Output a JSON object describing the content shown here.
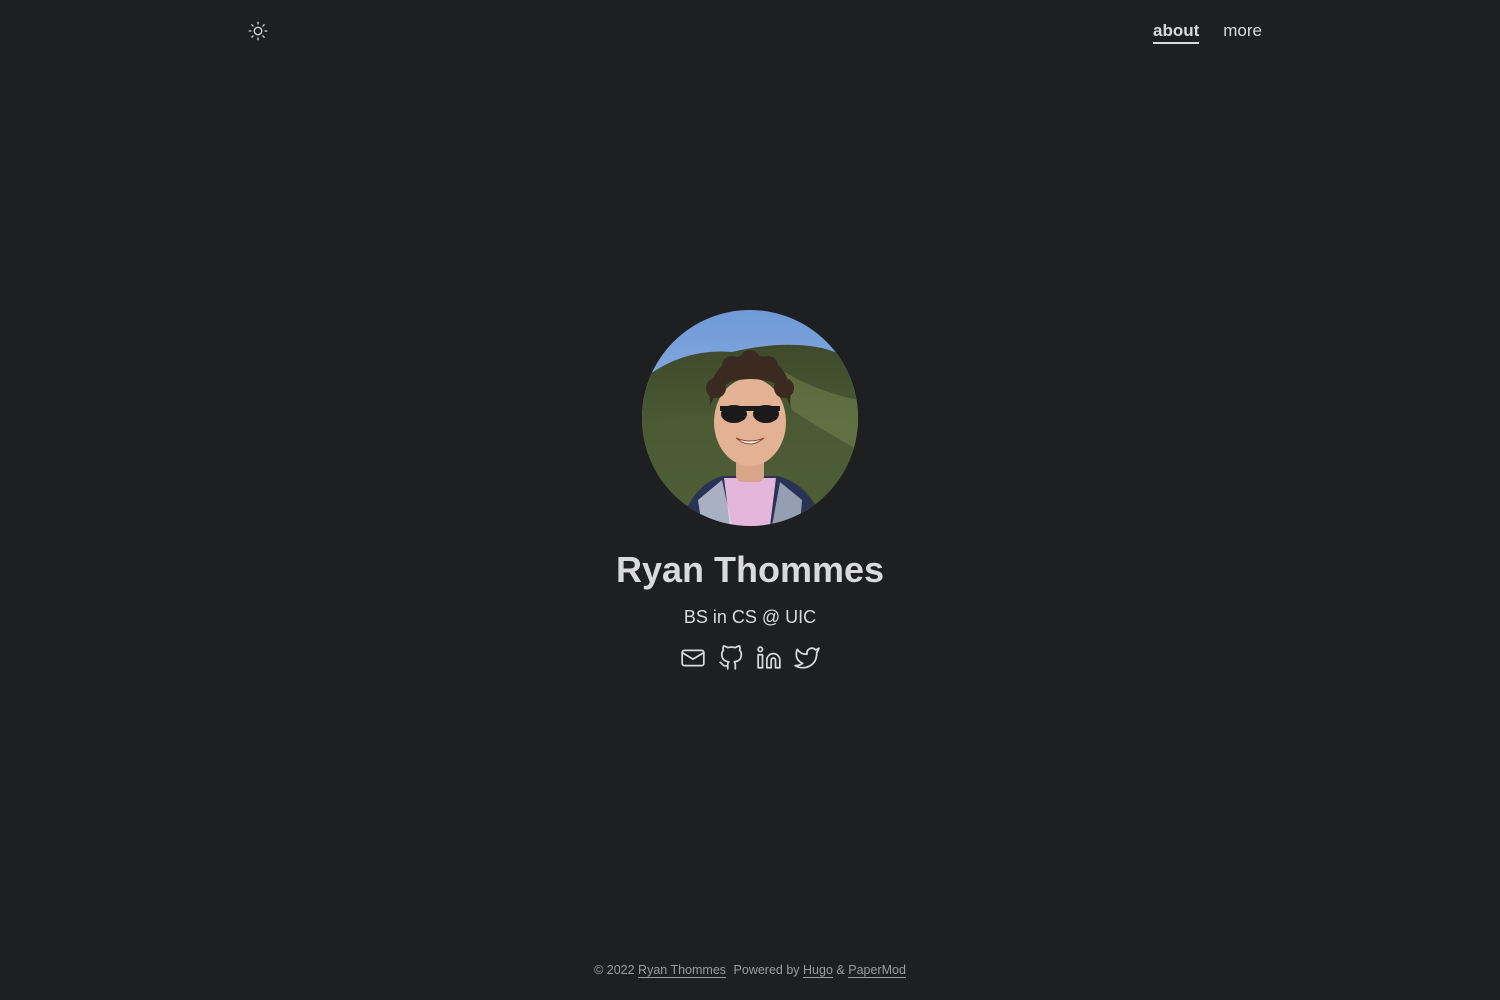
{
  "header": {
    "theme_toggle_icon": "sun-icon",
    "nav": [
      {
        "label": "about",
        "active": true
      },
      {
        "label": "more",
        "active": false
      }
    ]
  },
  "profile": {
    "name": "Ryan Thommes",
    "subtitle": "BS in CS @ UIC",
    "social": [
      {
        "icon": "email-icon"
      },
      {
        "icon": "github-icon"
      },
      {
        "icon": "linkedin-icon"
      },
      {
        "icon": "twitter-icon"
      }
    ]
  },
  "footer": {
    "copyright": "© 2022",
    "author": "Ryan Thommes",
    "powered_by": "Powered by",
    "hugo": "Hugo",
    "amp": "&",
    "papermod": "PaperMod"
  },
  "colors": {
    "background": "#1e1f21",
    "text": "#dadadb",
    "muted": "#9b9c9d"
  }
}
